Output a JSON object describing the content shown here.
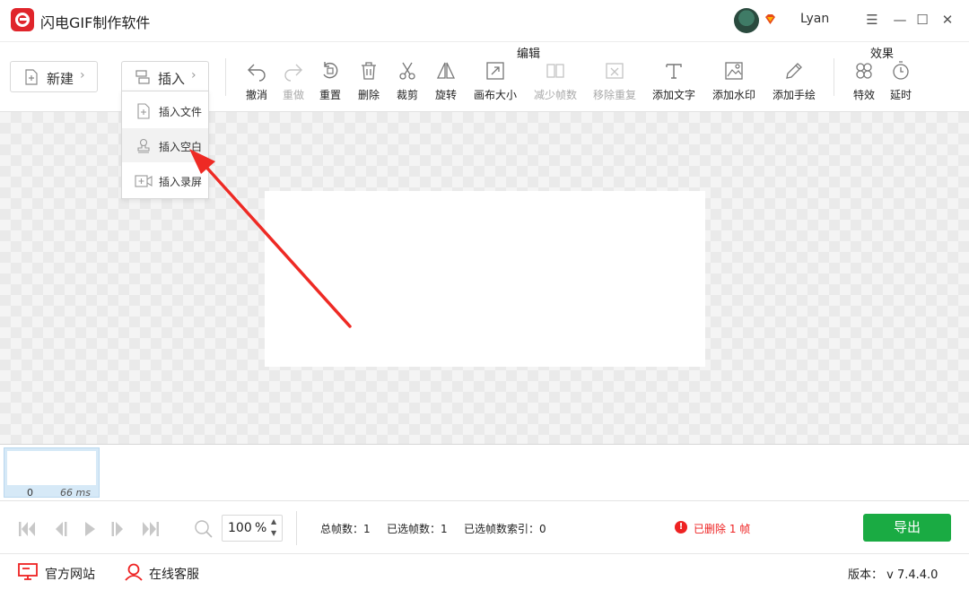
{
  "window": {
    "title": "闪电GIF制作软件",
    "username": "Lyan"
  },
  "toolbar": {
    "new_label": "新建",
    "insert_label": "插入",
    "group_edit": "编辑",
    "group_effect": "效果",
    "tools": {
      "undo": "撤消",
      "redo": "重做",
      "reset": "重置",
      "delete": "删除",
      "crop": "裁剪",
      "rotate": "旋转",
      "canvas_size": "画布大小",
      "reduce_frames": "减少帧数",
      "remove_duplicates": "移除重复",
      "add_text": "添加文字",
      "add_watermark": "添加水印",
      "add_drawing": "添加手绘",
      "effects": "特效",
      "delay": "延时"
    },
    "disabled": [
      "redo",
      "reduce_frames",
      "remove_duplicates"
    ]
  },
  "insert_menu": {
    "items": [
      {
        "label": "插入文件",
        "icon": "file-plus-icon"
      },
      {
        "label": "插入空白",
        "icon": "stamp-icon",
        "active": true
      },
      {
        "label": "插入录屏",
        "icon": "screen-record-icon"
      }
    ]
  },
  "timeline": {
    "frames": [
      {
        "index": "0",
        "delay": "66 ms"
      }
    ]
  },
  "playback": {
    "zoom_value": "100",
    "zoom_unit": "%",
    "total_frames": "总帧数：1",
    "selected_frames": "已选帧数：1",
    "selected_index": "已选帧数索引：0",
    "warning": "已删除 1 帧",
    "export_label": "导出"
  },
  "footer": {
    "website": "官方网站",
    "support": "在线客服",
    "version": "版本： v 7.4.4.0"
  },
  "colors": {
    "brand_red": "#e0252b",
    "export_green": "#1aab43",
    "warning_red": "#ee2222",
    "annotation_arrow": "#ee2a24"
  }
}
